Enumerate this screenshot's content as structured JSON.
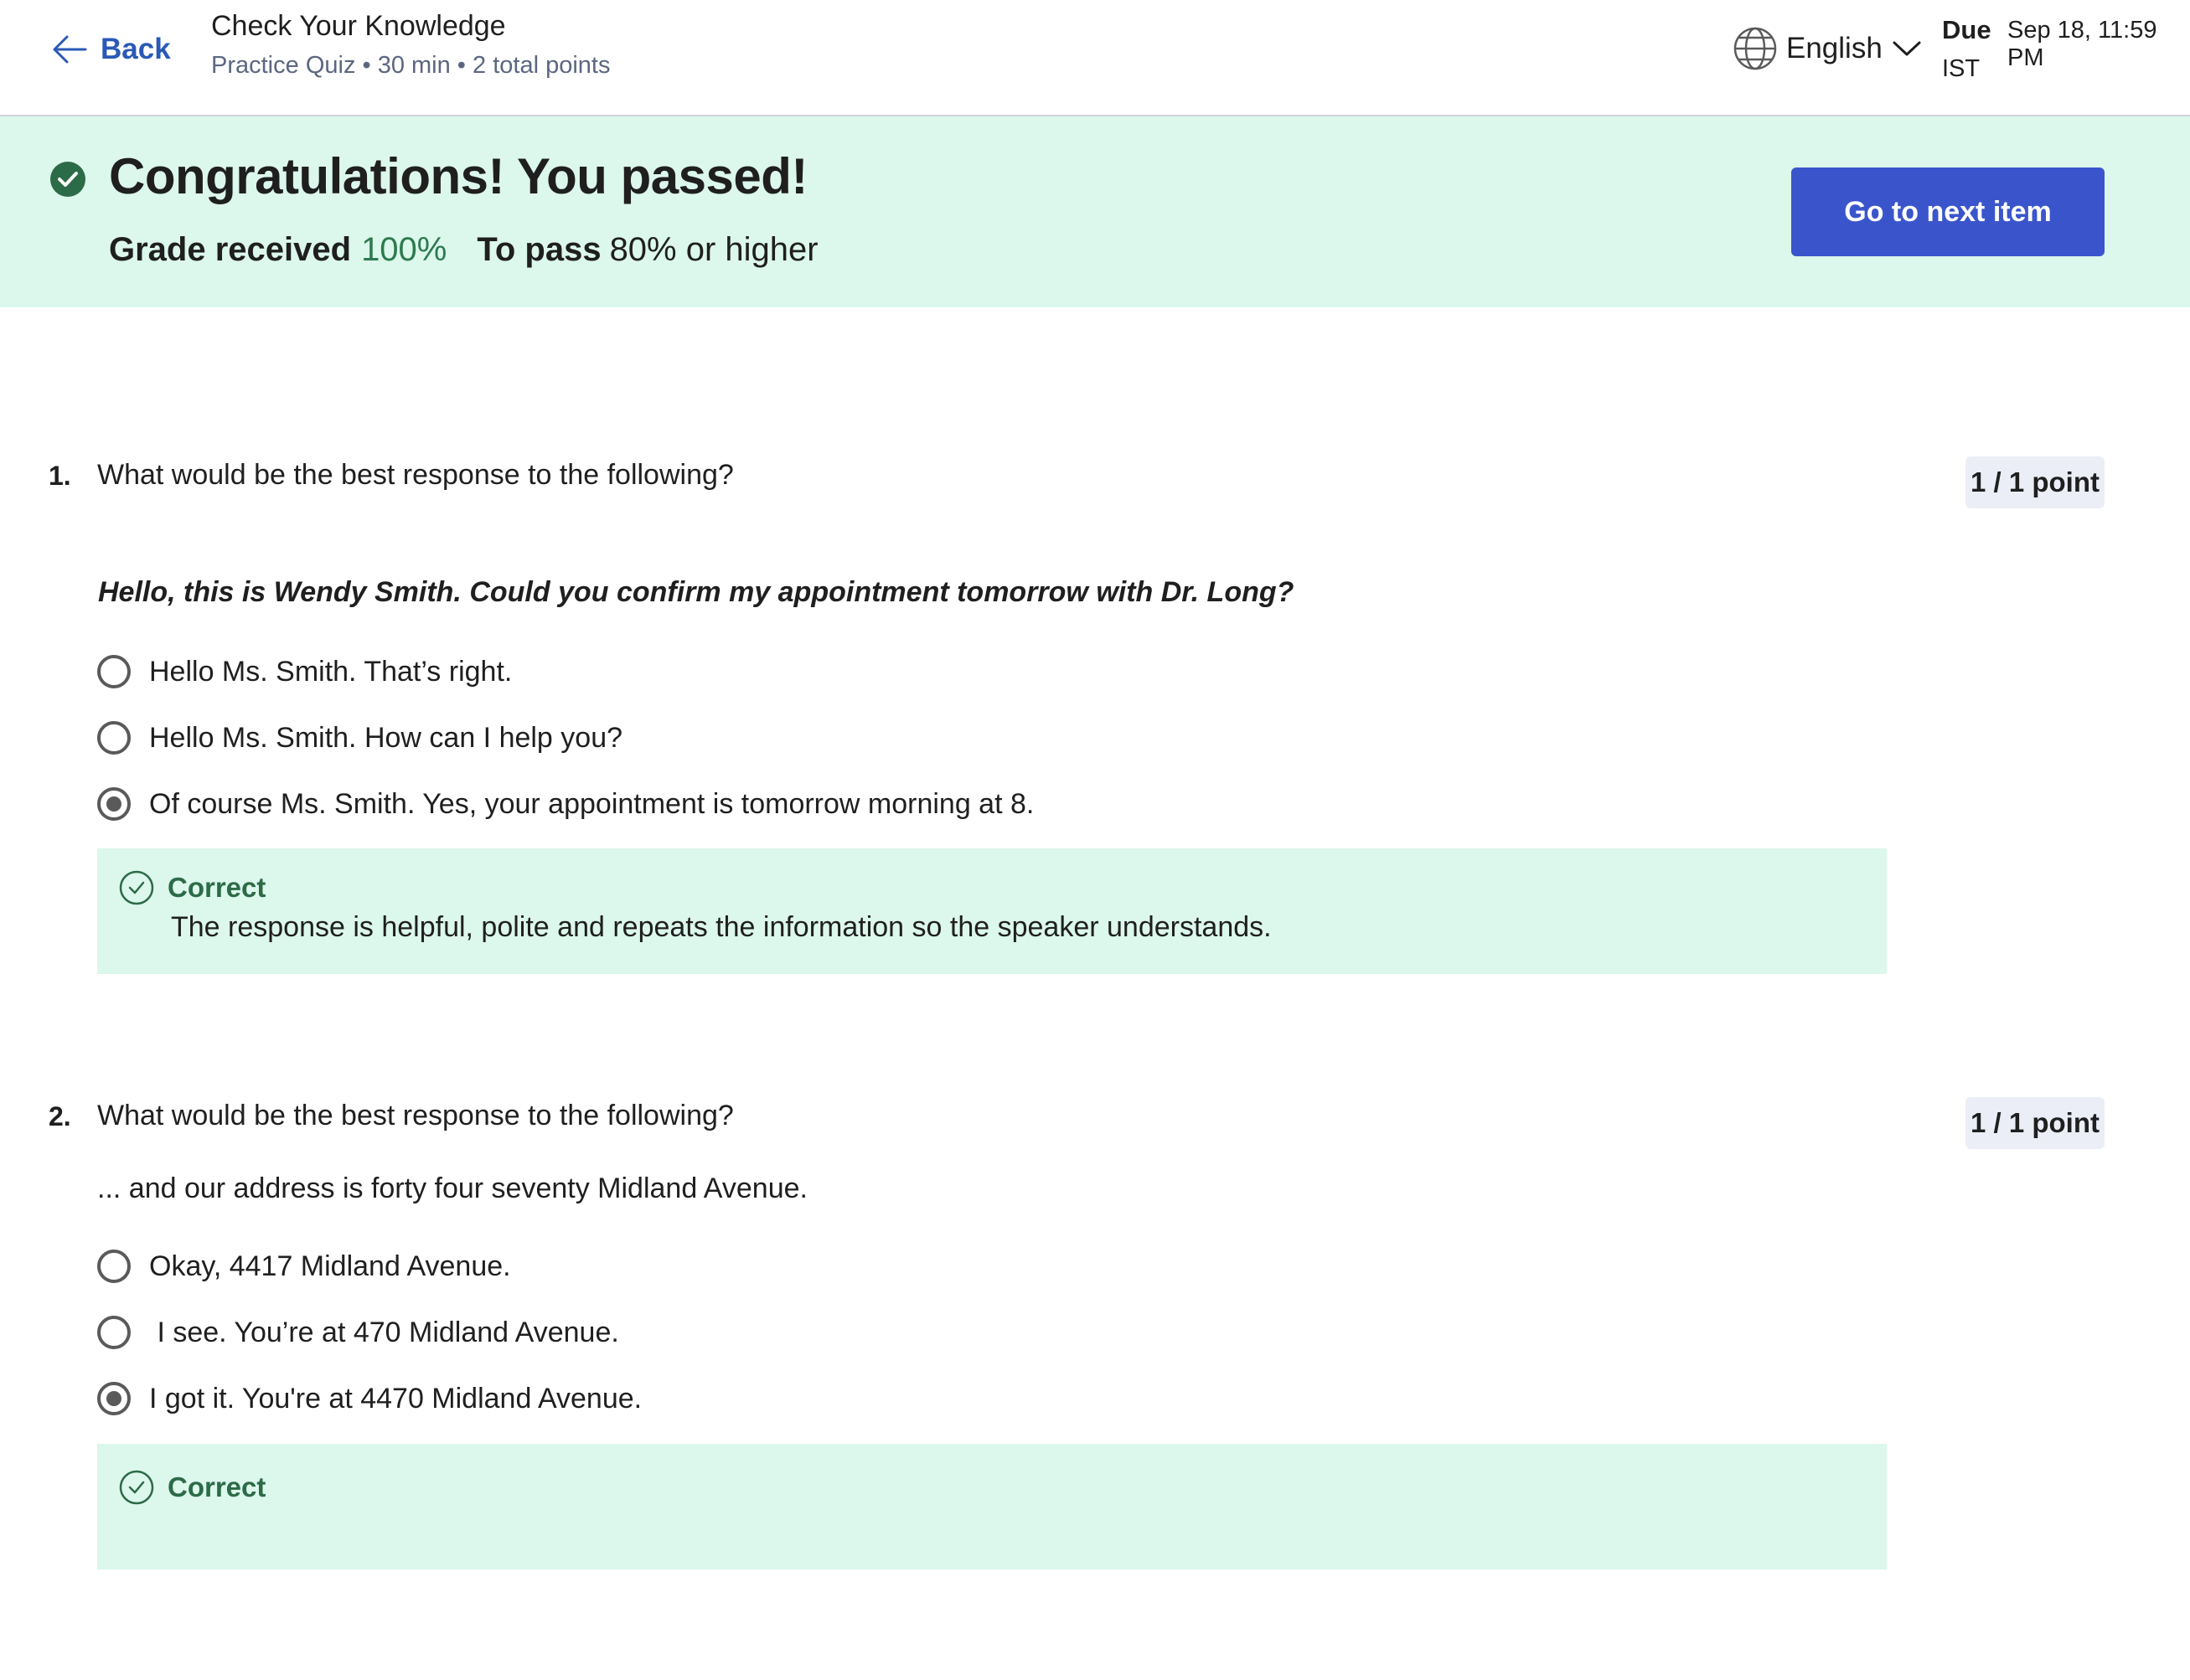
{
  "header": {
    "back_label": "Back",
    "title": "Check Your Knowledge",
    "subtitle": "Practice Quiz • 30 min • 2 total points",
    "language": "English",
    "due_label": "Due",
    "due_date": "Sep 18, 11:59 PM",
    "due_timezone": "IST"
  },
  "banner": {
    "title": "Congratulations! You passed!",
    "grade_label": "Grade received",
    "grade_value": "100%",
    "pass_label": "To pass",
    "pass_value": "80% or higher",
    "next_button": "Go to next item"
  },
  "questions": [
    {
      "number": "1.",
      "text": "What would be the best response to the following?",
      "points": "1 / 1 point",
      "prompt": "Hello, this is Wendy Smith. Could you confirm my appointment tomorrow with Dr. Long?",
      "options": [
        {
          "label": "Hello Ms. Smith. That’s right.",
          "selected": false
        },
        {
          "label": "Hello Ms. Smith. How can I help you?",
          "selected": false
        },
        {
          "label": "Of course Ms. Smith. Yes, your appointment is tomorrow morning at 8.",
          "selected": true
        }
      ],
      "feedback": {
        "label": "Correct",
        "text": "The response is helpful, polite and repeats the information so the speaker understands."
      }
    },
    {
      "number": "2.",
      "text": "What would be the best response to the following?",
      "points": "1 / 1 point",
      "prompt": "... and our address is forty four seventy Midland Avenue.",
      "options": [
        {
          "label": "Okay, 4417 Midland Avenue.",
          "selected": false
        },
        {
          "label": " I see. You’re at 470 Midland Avenue.",
          "selected": false
        },
        {
          "label": "I got it. You're at 4470 Midland Avenue.",
          "selected": true
        }
      ],
      "feedback": {
        "label": "Correct",
        "text": ""
      }
    }
  ],
  "colors": {
    "accent_blue": "#3a55cc",
    "link_blue": "#2a59b7",
    "success_bg": "#dcf7ec",
    "success_green": "#2c7a4e"
  }
}
